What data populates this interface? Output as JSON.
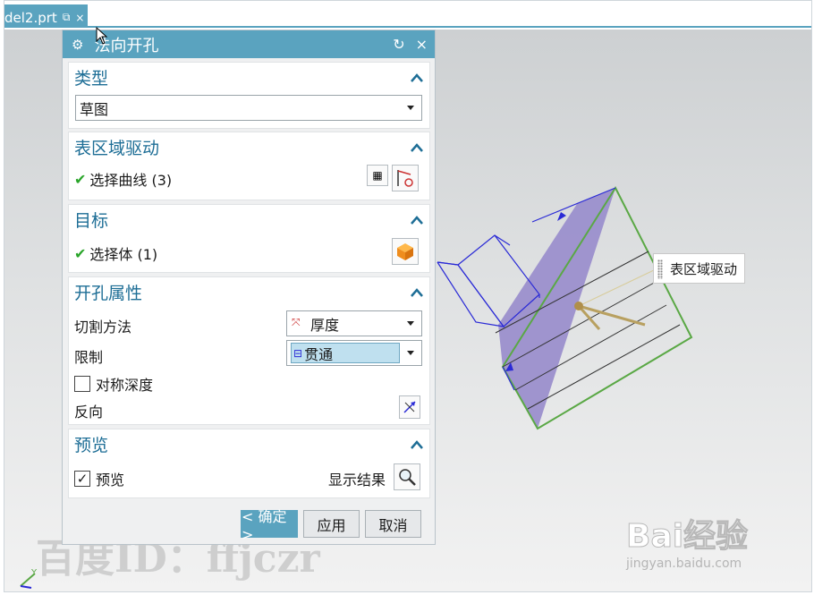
{
  "tab": {
    "label": "del2.prt",
    "pin_icon": "pin-icon",
    "close": "×"
  },
  "dialog": {
    "title": "法向开孔",
    "reset": "↻",
    "close": "×",
    "groups": {
      "type": {
        "title": "类型",
        "value": "草图"
      },
      "region": {
        "title": "表区域驱动",
        "select_label": "选择曲线 (3)"
      },
      "target": {
        "title": "目标",
        "select_label": "选择体 (1)"
      },
      "props": {
        "title": "开孔属性",
        "cut_method_label": "切割方法",
        "cut_method_value": "厚度",
        "limit_label": "限制",
        "limit_value": "贯通",
        "symmetric_label": "对称深度",
        "reverse_label": "反向"
      },
      "preview": {
        "title": "预览",
        "preview_label": "预览",
        "show_result_label": "显示结果"
      }
    },
    "buttons": {
      "ok": "< 确定 >",
      "apply": "应用",
      "cancel": "取消"
    }
  },
  "scene": {
    "callout_label": "表区域驱动",
    "axis_label": "Y"
  },
  "watermarks": {
    "text": "百度ID：ffjczr",
    "brand": "Bai经验",
    "brand_url": "jingyan.baidu.com"
  },
  "colors": {
    "accent": "#5aa3bf",
    "group_title": "#1e6e96",
    "face": "#9b8fcc",
    "edge": "#5aa845"
  }
}
